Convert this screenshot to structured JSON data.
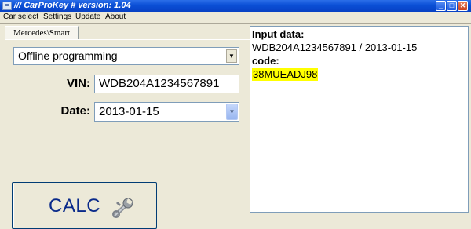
{
  "window": {
    "title": "/// CarProKey # version: 1.04",
    "controls": {
      "minimize": "_",
      "maximize": "□",
      "close": "✕"
    }
  },
  "menu": [
    "Car select",
    "Settings",
    "Update",
    "About"
  ],
  "brand_tab": "Mercedes\\Smart",
  "mode_select": {
    "value": "Offline programming"
  },
  "vin": {
    "label": "VIN:",
    "value": "WDB204A1234567891"
  },
  "date": {
    "label": "Date:",
    "value": "2013-01-15"
  },
  "calc_button": {
    "label": "CALC",
    "icon": "wrench-icon"
  },
  "result": {
    "input_head": "Input data:",
    "input_value": "WDB204A1234567891 / 2013-01-15",
    "code_head": "code:",
    "code_value": "38MUEADJ98"
  },
  "colors": {
    "titlebar": "#0a4fd6",
    "code_highlight": "#ffff00",
    "calc_text": "#0a2a8a"
  }
}
